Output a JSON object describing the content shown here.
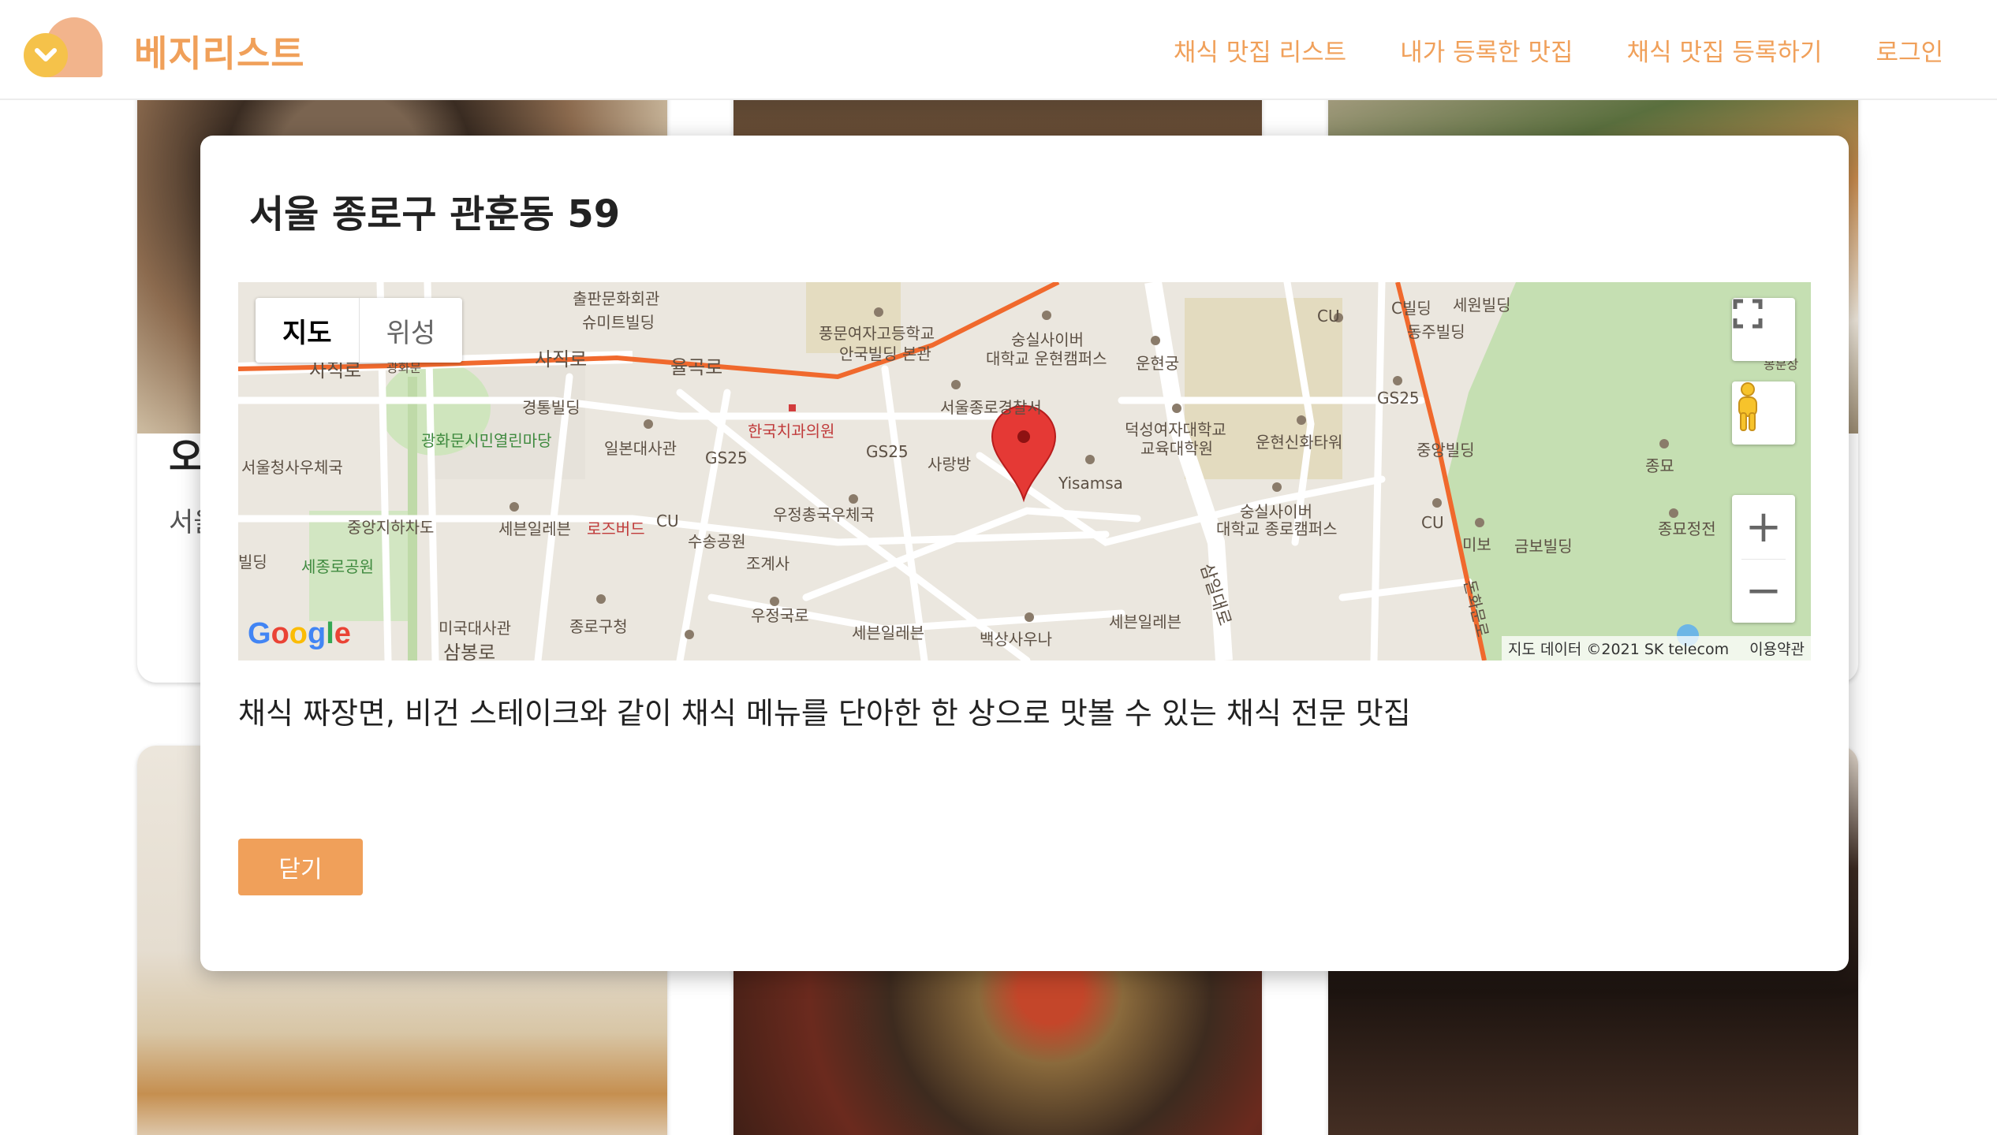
{
  "header": {
    "brand": "베지리스트",
    "nav": [
      {
        "label": "채식 맛집 리스트"
      },
      {
        "label": "내가 등록한 맛집"
      },
      {
        "label": "채식 맛집 등록하기"
      },
      {
        "label": "로그인"
      }
    ]
  },
  "cards": [
    {
      "title": "오",
      "subtitle": "서울"
    }
  ],
  "modal": {
    "title": "서울 종로구 관훈동 59",
    "description": "채식 짜장면, 비건 스테이크와 같이 채식 메뉴를 단아한 한 상으로 맛볼 수 있는 채식 전문 맛집",
    "close_label": "닫기"
  },
  "map": {
    "type_map": "지도",
    "type_satellite": "위성",
    "zoom_in": "+",
    "zoom_out": "−",
    "attribution": "지도 데이터 ©2021 SK telecom",
    "terms": "이용약관",
    "logo": "Google",
    "labels": [
      "출판문화회관",
      "슈미트빌딩",
      "사직로",
      "광화문",
      "사직로",
      "율곡로",
      "풍문여자고등학교",
      "안국빌딩 본관",
      "숭실사이버",
      "대학교 운현캠퍼스",
      "운현궁",
      "CU",
      "C빌딩",
      "세원빌딩",
      "동주빌딩",
      "봉분상",
      "경통빌딩",
      "광화문시민열린마당",
      "일본대사관",
      "한국치과의원",
      "GS25",
      "GS25",
      "서울종로경찰서",
      "사랑방",
      "덕성여자대학교",
      "교육대학원",
      "운현신화타워",
      "GS25",
      "중앙빌딩",
      "종묘",
      "서울청사우체국",
      "Yisamsa",
      "중앙지하차도",
      "세븐일레븐",
      "로즈버드",
      "CU",
      "우정총국우체국",
      "수송공원",
      "조계사",
      "숭실사이버",
      "대학교 종로캠퍼스",
      "CU",
      "미보",
      "금보빌딩",
      "종묘정전",
      "삼일대로",
      "돈화문로",
      "세종로공원",
      "우정국로",
      "세븐일레븐",
      "백상사우나",
      "세븐일레븐",
      "미국대사관",
      "종로구청",
      "삼봉로",
      "빌딩"
    ]
  },
  "colors": {
    "accent": "#f0a05a",
    "marker": "#e53935",
    "road_major": "#f0692d"
  }
}
